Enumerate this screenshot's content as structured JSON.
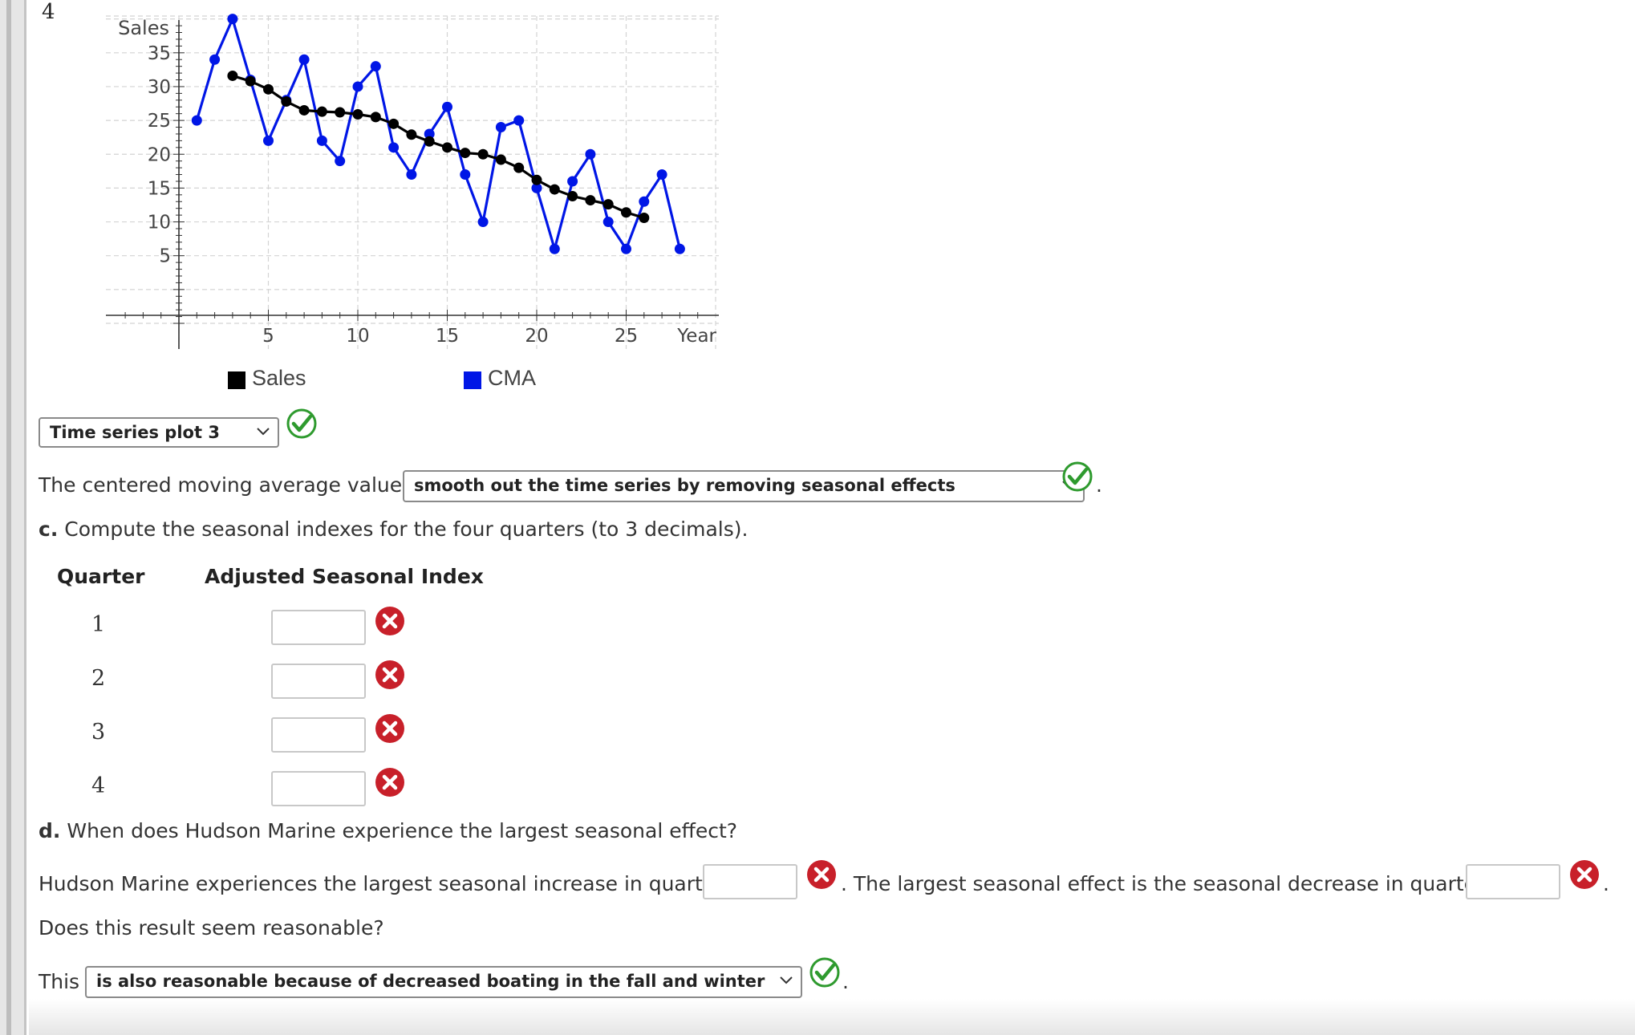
{
  "question_number": "4",
  "chart_data": {
    "type": "line",
    "ylabel": "Sales",
    "xlabel": "Year",
    "xticks": [
      5,
      10,
      15,
      20,
      25
    ],
    "yticks": [
      5,
      10,
      15,
      20,
      25,
      30,
      35
    ],
    "xlim": [
      0,
      30
    ],
    "ylim": [
      -5,
      40
    ],
    "grid": true,
    "legend": [
      {
        "label": "Sales",
        "color": "#000000"
      },
      {
        "label": "CMA",
        "color": "#0016e6"
      }
    ],
    "series": [
      {
        "color": "#0016e6",
        "x": [
          1,
          2,
          3,
          4,
          5,
          6,
          7,
          8,
          9,
          10,
          11,
          12,
          13,
          14,
          15,
          16,
          17,
          18,
          19,
          20,
          21,
          22,
          23,
          24,
          25,
          26,
          27,
          28
        ],
        "y": [
          25,
          34,
          40,
          31,
          22,
          28,
          34,
          22,
          19,
          30,
          33,
          21,
          17,
          23,
          27,
          17,
          10,
          24,
          25,
          15,
          6,
          16,
          20,
          10,
          6,
          13,
          17,
          6
        ]
      },
      {
        "color": "#000000",
        "x": [
          3,
          4,
          5,
          6,
          7,
          8,
          9,
          10,
          11,
          12,
          13,
          14,
          15,
          16,
          17,
          18,
          19,
          20,
          21,
          22,
          23,
          24,
          25,
          26
        ],
        "y": [
          31.6,
          30.8,
          29.6,
          27.8,
          26.5,
          26.3,
          26.2,
          25.9,
          25.5,
          24.5,
          22.9,
          21.9,
          21.0,
          20.2,
          20.0,
          19.2,
          18.0,
          16.2,
          14.8,
          13.8,
          13.2,
          12.6,
          11.4,
          10.6
        ]
      }
    ]
  },
  "q_b": {
    "plot_select": "Time series plot 3",
    "cma_prefix": "The centered moving average values",
    "cma_select": "smooth out the time series by removing seasonal effects"
  },
  "q_c": {
    "label": "c.",
    "prompt": "Compute the seasonal indexes for the four quarters (to 3 decimals).",
    "col_quarter": "Quarter",
    "col_index": "Adjusted Seasonal Index",
    "quarters": [
      "1",
      "2",
      "3",
      "4"
    ],
    "values": [
      "",
      "",
      "",
      ""
    ]
  },
  "q_d": {
    "label": "d.",
    "prompt": "When does Hudson Marine experience the largest seasonal effect?",
    "increase_text": "Hudson Marine experiences the largest seasonal increase in quarter",
    "increase_value": "",
    "decrease_text": ". The largest seasonal effect is the seasonal decrease in quarter",
    "decrease_value": "",
    "period": ".",
    "reasonable_q": "Does this result seem reasonable?",
    "this_prefix": "This",
    "reason_select": "is also reasonable because of decreased boating in the fall and winter",
    "end_period": "."
  },
  "colors": {
    "correct": "#2e9a2e",
    "incorrect": "#c8202a",
    "cma_line": "#0016e6",
    "sales_line": "#000000"
  }
}
